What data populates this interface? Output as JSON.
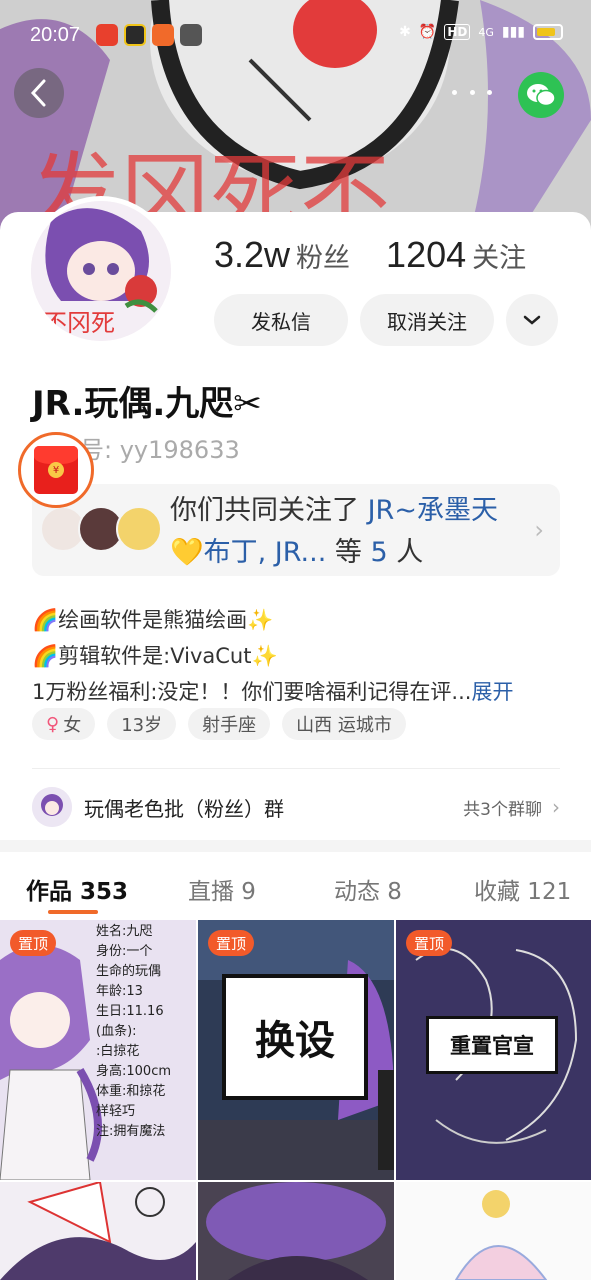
{
  "status_bar": {
    "time": "20:07",
    "network": "4G",
    "icons": [
      "bluetooth-icon",
      "alarm-icon",
      "hd-icon",
      "signal-icon",
      "battery-icon"
    ],
    "hd_label": "HD"
  },
  "header": {
    "banner_text": "发冈死不",
    "back_icon": "chevron-left-icon",
    "more_icon": "more-dots-icon",
    "share_icon": "wechat-icon"
  },
  "profile": {
    "followers_count": "3.2w",
    "followers_label": "粉丝",
    "following_count": "1204",
    "following_label": "关注",
    "message_button": "发私信",
    "unfollow_button": "取消关注",
    "nickname": "JR.玩偶.九咫✂",
    "user_id": "快手号: yy198633",
    "avatar_text": "不冈死"
  },
  "common_follow": {
    "prefix": "你们共同关注了",
    "names": "JR~承墨天💛布丁, JR...",
    "suffix_pre": "等",
    "count": "5",
    "suffix_post": "人"
  },
  "bio": {
    "line1": "🌈绘画软件是熊猫绘画✨",
    "line2": "🌈剪辑软件是:VivaCut✨",
    "line3": "1万粉丝福利:没定！！你们要啥福利记得在评...",
    "expand": "展开"
  },
  "tags": [
    {
      "label": "女",
      "icon": "female-icon"
    },
    {
      "label": "13岁"
    },
    {
      "label": "射手座"
    },
    {
      "label": "山西 运城市"
    }
  ],
  "group": {
    "name": "玩偶老色批（粉丝）群",
    "count": "共3个群聊"
  },
  "tabs": [
    {
      "label": "作品 353",
      "active": true
    },
    {
      "label": "直播 9"
    },
    {
      "label": "动态 8"
    },
    {
      "label": "收藏 121"
    }
  ],
  "works": {
    "pin_label": "置顶",
    "item1_lines": [
      "姓名:九咫",
      "身份:一个",
      "生命的玩偶",
      "年龄:13",
      "生日:11.16",
      "(血条):",
      ":白掠花",
      "身高:100cm",
      "体重:和掠花",
      "样轻巧",
      "注:拥有魔法"
    ],
    "item2_sign": "换设",
    "item3_sign": "重置官宣"
  },
  "colors": {
    "accent": "#f06a2a",
    "link": "#2b5fa8",
    "pin": "#f25a2a",
    "wechat": "#2ec254"
  }
}
